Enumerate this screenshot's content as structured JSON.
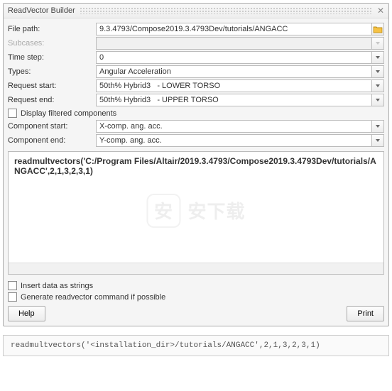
{
  "titlebar": {
    "title": "ReadVector Builder"
  },
  "form": {
    "filepath_label": "File path:",
    "filepath_value": "9.3.4793/Compose2019.3.4793Dev/tutorials/ANGACC",
    "subcases_label": "Subcases:",
    "subcases_value": "",
    "timestep_label": "Time step:",
    "timestep_value": "0",
    "types_label": "Types:",
    "types_value": "Angular Acceleration",
    "reqstart_label": "Request start:",
    "reqstart_value": "50th% Hybrid3   - LOWER TORSO",
    "reqend_label": "Request end:",
    "reqend_value": "50th% Hybrid3   - UPPER TORSO",
    "display_filtered_label": "Display filtered components",
    "compstart_label": "Component start:",
    "compstart_value": "X-comp. ang. acc.",
    "compend_label": "Component end:",
    "compend_value": "Y-comp. ang. acc."
  },
  "code_area": {
    "content": "readmultvectors('C:/Program Files/Altair/2019.3.4793/Compose2019.3.4793Dev/tutorials/ANGACC',2,1,3,2,3,1)"
  },
  "checkboxes": {
    "insert_strings": "Insert data as strings",
    "generate_cmd": "Generate readvector command if possible"
  },
  "buttons": {
    "help": "Help",
    "print": "Print"
  },
  "output": {
    "text": "readmultvectors('<installation_dir>/tutorials/ANGACC',2,1,3,2,3,1)"
  }
}
